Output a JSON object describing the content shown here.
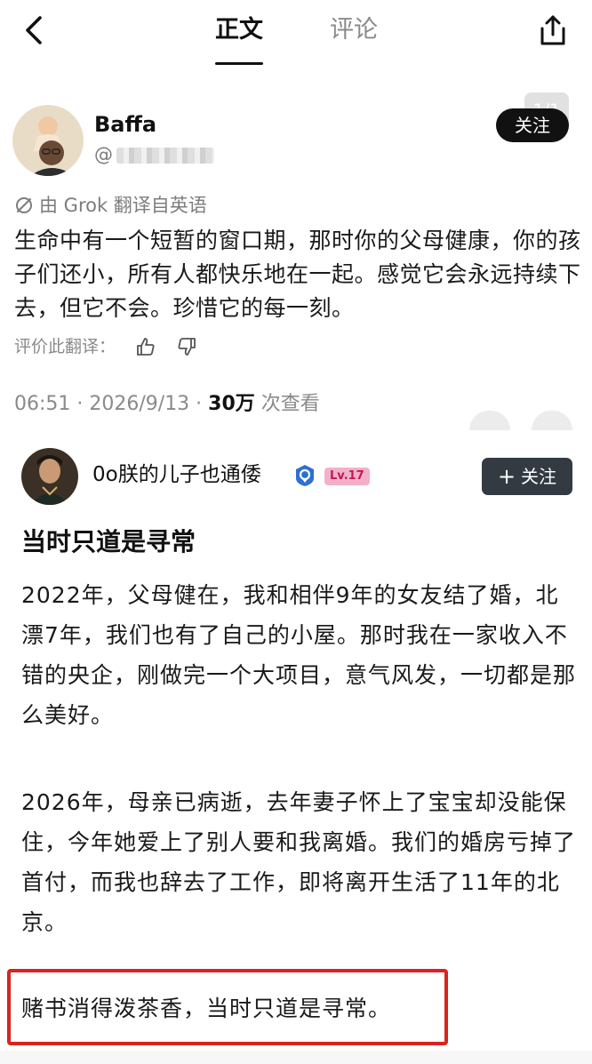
{
  "nav": {
    "tab_main": "正文",
    "tab_comments": "评论"
  },
  "tweet": {
    "name": "Baffa",
    "handle_prefix": "@",
    "page_indicator": "1/1",
    "follow_label": "关注",
    "translate_note": "由 Grok 翻译自英语",
    "body": "生命中有一个短暂的窗口期，那时你的父母健康，你的孩子们还小，所有人都快乐地在一起。感觉它会永远持续下去，但它不会。珍惜它的每一刻。",
    "rate_label": "评价此翻译：",
    "time_date": "06:51 · 2026/9/13 · ",
    "views_count": "30万",
    "views_suffix": " 次查看"
  },
  "post": {
    "author": "0o朕的儿子也通倭",
    "level": "Lv.17",
    "follow_label": "关注",
    "title": "当时只道是寻常",
    "paragraph_1": "2022年，父母健在，我和相伴9年的女友结了婚，北漂7年，我们也有了自己的小屋。那时我在一家收入不错的央企，刚做完一个大项目，意气风发，一切都是那么美好。",
    "paragraph_2": "2026年，母亲已病逝，去年妻子怀上了宝宝却没能保住，今年她爱上了别人要和我离婚。我们的婚房亏掉了首付，而我也辞去了工作，即将离开生活了11年的北京。",
    "highlight": "赌书消得泼茶香，当时只道是寻常。"
  },
  "colors": {
    "highlight_border": "#d9231f",
    "follow_button": "#333a42",
    "level_badge_bg": "#f3b0c8",
    "verified_badge": "#2f6fd1"
  },
  "icons": {
    "back": "chevron-left-icon",
    "share": "share-icon",
    "translate": "translate-link-icon",
    "thumb_up": "thumb-up-icon",
    "thumb_down": "thumb-down-icon",
    "verified": "verified-badge-icon"
  }
}
